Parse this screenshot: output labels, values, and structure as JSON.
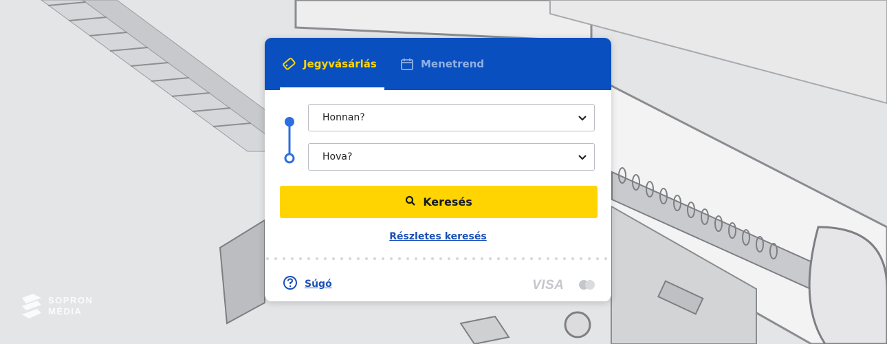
{
  "watermark": {
    "text": "SOPRON\nMÉDIA"
  },
  "tabs": [
    {
      "label": "Jegyvásárlás",
      "icon": "ticket-icon",
      "active": true
    },
    {
      "label": "Menetrend",
      "icon": "calendar-icon",
      "active": false
    }
  ],
  "form": {
    "from": {
      "placeholder": "Honnan?"
    },
    "to": {
      "placeholder": "Hova?"
    },
    "search_label": "Keresés",
    "advanced_search_label": "Részletes keresés"
  },
  "footer": {
    "help_label": "Súgó",
    "payment_visa": "VISA",
    "payment_icons": [
      "visa-logo",
      "mastercard-icon"
    ]
  },
  "colors": {
    "header_blue": "#0a4fbf",
    "accent_yellow": "#ffd400",
    "link_blue": "#1a4fb6",
    "route_blue": "#2d6ee0"
  }
}
